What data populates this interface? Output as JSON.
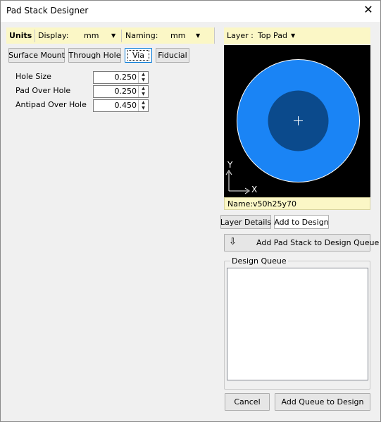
{
  "window": {
    "title": "Pad Stack Designer"
  },
  "units": {
    "label": "Units",
    "display_label": "Display:",
    "display_value": "mm",
    "naming_label": "Naming:",
    "naming_value": "mm"
  },
  "pad_types": [
    "Surface Mount",
    "Through Hole",
    "Via",
    "Fiducial"
  ],
  "selected_pad_type": "Via",
  "params": [
    {
      "label": "Hole Size",
      "value": "0.250"
    },
    {
      "label": "Pad Over Hole",
      "value": "0.250"
    },
    {
      "label": "Antipad Over Hole",
      "value": "0.450"
    }
  ],
  "layer": {
    "label": "Layer :",
    "value": "Top Pad"
  },
  "preview": {
    "axis_y": "Y",
    "axis_x": "X",
    "outer_color": "#1a84f5",
    "inner_color": "#0b4a8c",
    "background": "#000000"
  },
  "name_bar": {
    "label": "Name:",
    "value": "v50h25y70"
  },
  "detail_tabs": [
    "Layer Details",
    "Add to Design"
  ],
  "add_queue_button": "Add Pad Stack to Design Queue",
  "design_queue": {
    "label": "Design Queue",
    "items": []
  },
  "footer": {
    "cancel": "Cancel",
    "add_to_design": "Add Queue to Design"
  }
}
